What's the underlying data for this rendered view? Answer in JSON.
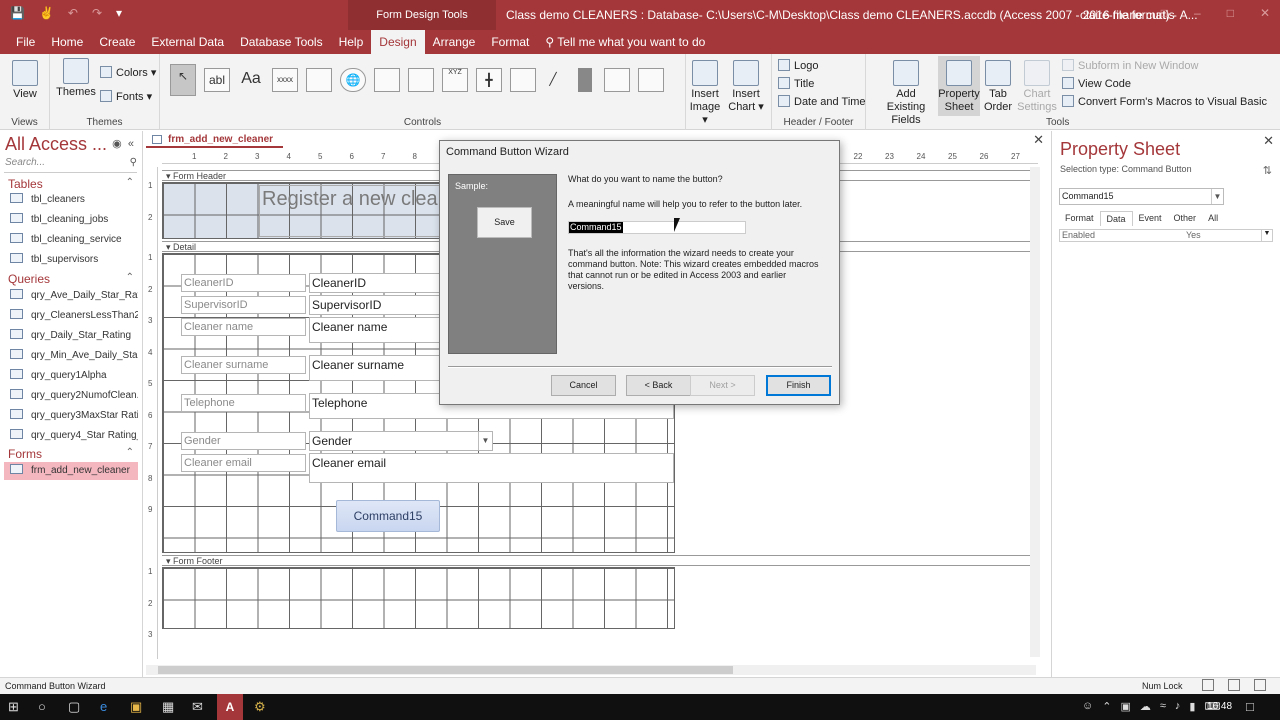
{
  "titlebar": {
    "context_tab": "Form Design Tools",
    "doc_title": "Class demo CLEANERS : Database- C:\\Users\\C-M\\Desktop\\Class demo CLEANERS.accdb (Access 2007 - 2016 file format) - A...",
    "user": "claire-marie curtis"
  },
  "tabs": [
    "File",
    "Home",
    "Create",
    "External Data",
    "Database Tools",
    "Help",
    "Design",
    "Arrange",
    "Format"
  ],
  "active_tab": "Design",
  "tell_me": "Tell me what you want to do",
  "ribbon": {
    "views_label": "View",
    "views_group": "Views",
    "themes_label": "Themes",
    "colors_label": "Colors",
    "fonts_label": "Fonts",
    "themes_group": "Themes",
    "controls_group": "Controls",
    "insert_image": [
      "Insert",
      "Image"
    ],
    "insert_chart": [
      "Insert",
      "Chart"
    ],
    "logo": "Logo",
    "title": "Title",
    "date_time": "Date and Time",
    "header_footer_group": "Header / Footer",
    "add_existing": [
      "Add Existing",
      "Fields"
    ],
    "property_sheet": [
      "Property",
      "Sheet"
    ],
    "tab_order": [
      "Tab",
      "Order"
    ],
    "chart_settings": [
      "Chart",
      "Settings"
    ],
    "subform_new_window": "Subform in New Window",
    "view_code": "View Code",
    "convert_macros": "Convert Form's Macros to Visual Basic",
    "tools_group": "Tools",
    "control_glyphs": [
      "abl",
      "Aa",
      "xxxx",
      "XYZ"
    ]
  },
  "nav": {
    "title": "All Access ...",
    "search_placeholder": "Search...",
    "tables_header": "Tables",
    "tables": [
      "tbl_cleaners",
      "tbl_cleaning_jobs",
      "tbl_cleaning_service",
      "tbl_supervisors"
    ],
    "queries_header": "Queries",
    "queries": [
      "qry_Ave_Daily_Star_Rating",
      "qry_CleanersLessThan25...",
      "qry_Daily_Star_Rating",
      "qry_Min_Ave_Daily_Star_...",
      "qry_query1Alpha",
      "qry_query2NumofClean...",
      "qry_query3MaxStar Rati...",
      "qry_query4_Star Rating_..."
    ],
    "forms_header": "Forms",
    "forms": [
      "frm_add_new_cleaner"
    ]
  },
  "document": {
    "tab_name": "frm_add_new_cleaner",
    "ruler_ticks": [
      "1",
      "2",
      "3",
      "4",
      "5",
      "6",
      "7",
      "8",
      "9",
      "10",
      "11",
      "12",
      "13",
      "14",
      "15",
      "16",
      "17",
      "18",
      "19",
      "20",
      "21",
      "22",
      "23",
      "24",
      "25",
      "26",
      "27"
    ],
    "vruler_header": [
      "1",
      "2"
    ],
    "vruler_detail": [
      "1",
      "2",
      "3",
      "4",
      "5",
      "6",
      "7",
      "8",
      "9"
    ],
    "vruler_footer": [
      "1",
      "2",
      "3"
    ],
    "form_header_label": "Form Header",
    "header_title": "Register a new cleaner",
    "detail_label": "Detail",
    "form_footer_label": "Form Footer",
    "fields": [
      {
        "label": "CleanerID",
        "control": "CleanerID"
      },
      {
        "label": "SupervisorID",
        "control": "SupervisorID"
      },
      {
        "label": "Cleaner name",
        "control": "Cleaner name"
      },
      {
        "label": "Cleaner surname",
        "control": "Cleaner surname"
      },
      {
        "label": "Telephone",
        "control": "Telephone"
      },
      {
        "label": "Gender",
        "control": "Gender"
      },
      {
        "label": "Cleaner email",
        "control": "Cleaner email"
      }
    ],
    "command_button": "Command15"
  },
  "property_sheet": {
    "title": "Property Sheet",
    "selection_type": "Selection type: Command Button",
    "selected_object": "Command15",
    "tabs": [
      "Format",
      "Data",
      "Event",
      "Other",
      "All"
    ],
    "active_tab": "Data",
    "rows": [
      {
        "name": "Enabled",
        "value": "Yes"
      }
    ]
  },
  "wizard": {
    "title": "Command Button Wizard",
    "sample_label": "Sample:",
    "sample_button": "Save",
    "question": "What do you want to name the button?",
    "hint": "A meaningful name will help you to refer to the button later.",
    "name_value": "Command15",
    "info": "That's all the information the wizard needs to create your command button. Note: This wizard creates embedded macros that cannot run or be edited in Access 2003 and earlier versions.",
    "cancel": "Cancel",
    "back": "< Back",
    "next": "Next >",
    "finish": "Finish"
  },
  "status": {
    "text": "Command Button Wizard",
    "num_lock": "Num Lock"
  },
  "taskbar": {
    "time": "16:48",
    "access_icon": "A"
  }
}
